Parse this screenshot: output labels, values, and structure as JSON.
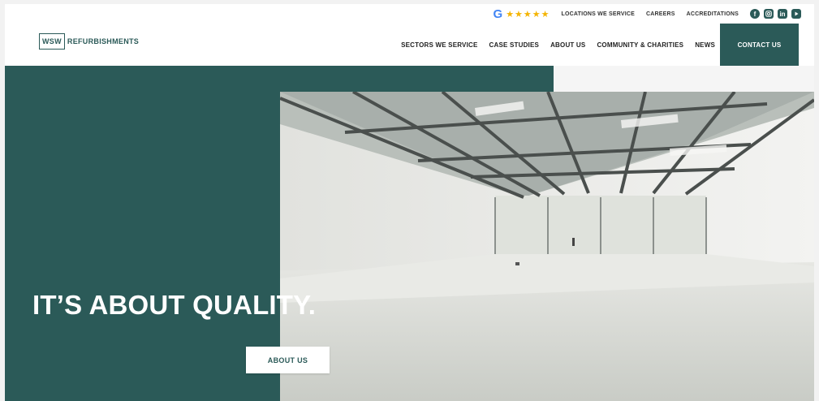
{
  "topbar": {
    "google_letter": "G",
    "stars": "★★★★★",
    "links": [
      "LOCATIONS WE SERVICE",
      "CAREERS",
      "ACCREDITATIONS"
    ],
    "social_icons": [
      "facebook-icon",
      "instagram-icon",
      "linkedin-icon",
      "youtube-icon"
    ]
  },
  "header": {
    "logo_box": "WSW",
    "logo_text": "REFURBISHMENTS",
    "menu": [
      "SECTORS WE SERVICE",
      "CASE STUDIES",
      "ABOUT US",
      "COMMUNITY & CHARITIES",
      "NEWS"
    ],
    "contact_label": "CONTACT US"
  },
  "hero": {
    "title": "IT’S ABOUT QUALITY.",
    "button_label": "ABOUT US"
  },
  "colors": {
    "brand": "#2b5a58",
    "google_blue": "#4285f4",
    "star": "#f4b400"
  }
}
